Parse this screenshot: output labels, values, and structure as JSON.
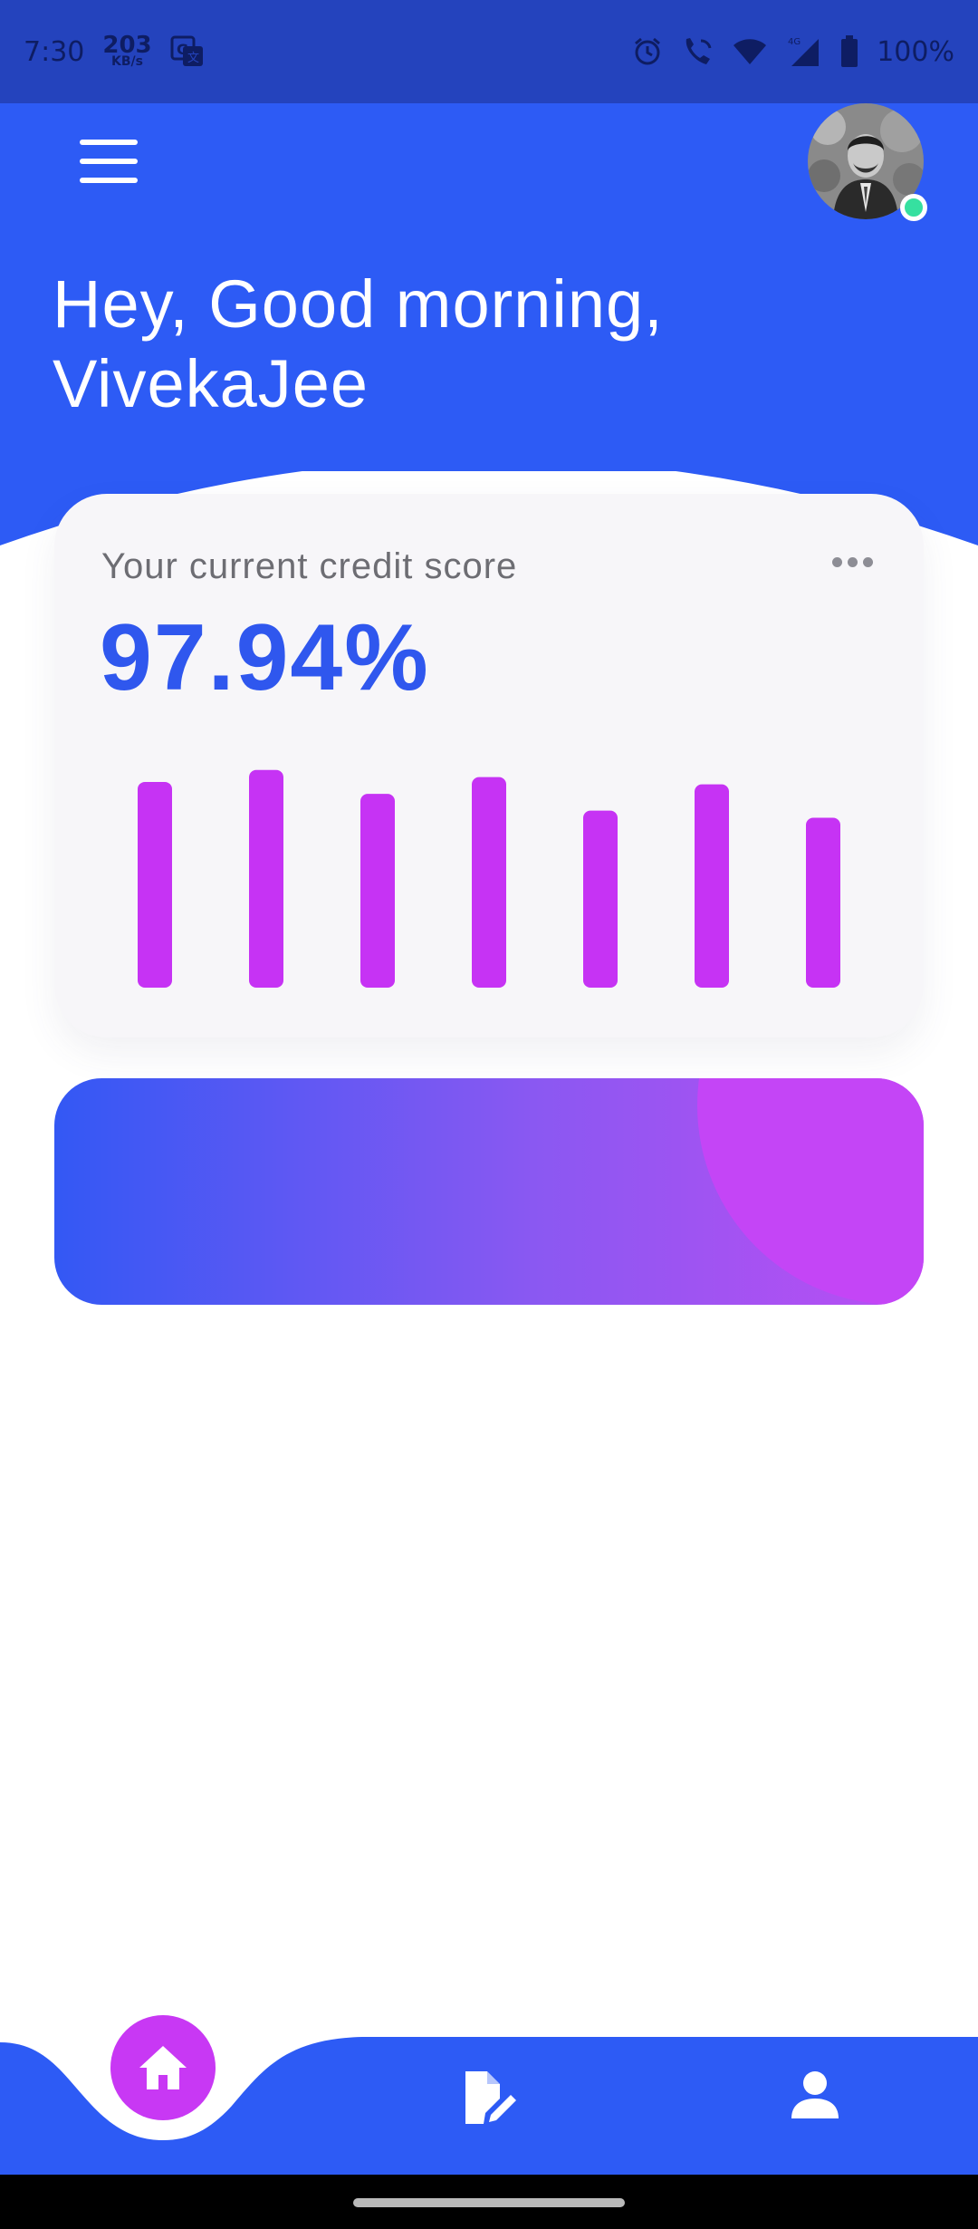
{
  "status_bar": {
    "time": "7:30",
    "speed_value": "203",
    "speed_unit": "KB/s",
    "battery": "100%",
    "icons": [
      "translate-icon",
      "alarm-icon",
      "wifi-call-icon",
      "wifi-icon",
      "signal-icon",
      "battery-icon"
    ]
  },
  "header": {
    "menu_icon": "hamburger-menu-icon",
    "greeting": "Hey, Good morning, VivekaJee",
    "avatar_status": "online",
    "colors": {
      "background": "#2d5bf5",
      "status_bar": "#2443bd",
      "online": "#36e0a0"
    }
  },
  "credit_card": {
    "label": "Your current credit score",
    "score": "97.94%",
    "more_icon": "more-dots-icon",
    "chart_data": {
      "type": "bar",
      "categories": [
        "",
        "",
        "",
        "",
        "",
        "",
        ""
      ],
      "values": [
        0.86,
        0.91,
        0.81,
        0.88,
        0.74,
        0.85,
        0.71
      ],
      "color": "#c633f4",
      "grid": false
    }
  },
  "banner": {
    "gradient": [
      "#3358f4",
      "#8a58f2",
      "#bb4ef3"
    ],
    "circle_color": "#c445f6"
  },
  "bottom_nav": {
    "items": [
      {
        "name": "home",
        "icon": "home-icon",
        "active": true
      },
      {
        "name": "edit-document",
        "icon": "edit-document-icon",
        "active": false
      },
      {
        "name": "profile",
        "icon": "person-icon",
        "active": false
      }
    ],
    "colors": {
      "background": "#2d5bf5",
      "active": "#c838f4"
    }
  }
}
